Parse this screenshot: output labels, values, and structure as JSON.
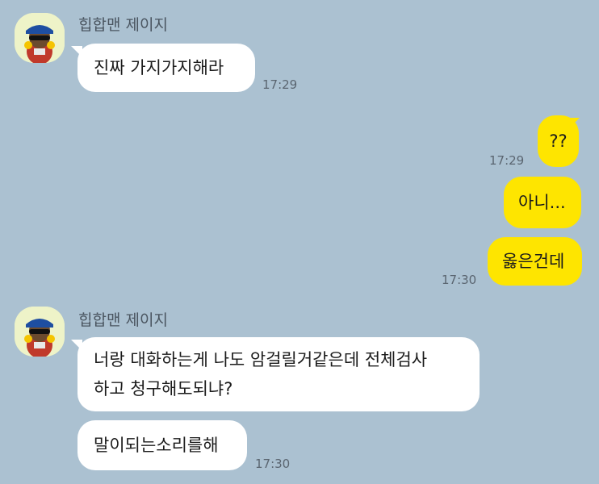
{
  "colors": {
    "background": "#abc1d1",
    "incoming_bubble": "#ffffff",
    "outgoing_bubble": "#fee500",
    "avatar_background": "#eef3c8"
  },
  "messages": [
    {
      "sender": "힙합맨 제이지",
      "avatar_icon": "hiphop-character-avatar-icon",
      "text": "진짜 가지가지해라",
      "time": "17:29"
    },
    {
      "text": "??",
      "time": "17:29"
    },
    {
      "text": "아니..."
    },
    {
      "text": "옳은건데",
      "time": "17:30"
    },
    {
      "sender": "힙합맨 제이지",
      "avatar_icon": "hiphop-character-avatar-icon",
      "line1": "너랑 대화하는게 나도 암걸릴거같은데 전체검사",
      "line2": "하고 청구해도되냐?"
    },
    {
      "text": "말이되는소리를해",
      "time": "17:30"
    }
  ]
}
